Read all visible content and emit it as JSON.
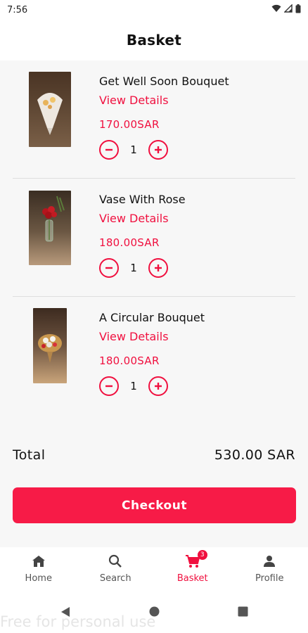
{
  "status_bar": {
    "time": "7:56"
  },
  "header": {
    "title": "Basket"
  },
  "items": [
    {
      "name": "Get Well Soon Bouquet",
      "details_label": "View Details",
      "price": "170.00SAR",
      "quantity": "1"
    },
    {
      "name": "Vase With Rose",
      "details_label": "View Details",
      "price": "180.00SAR",
      "quantity": "1"
    },
    {
      "name": "A Circular Bouquet",
      "details_label": "View Details",
      "price": "180.00SAR",
      "quantity": "1"
    }
  ],
  "total": {
    "label": "Total",
    "value": "530.00 SAR"
  },
  "checkout": {
    "label": "Checkout"
  },
  "bottom_nav": {
    "items": [
      {
        "label": "Home",
        "icon": "home-icon"
      },
      {
        "label": "Search",
        "icon": "search-icon"
      },
      {
        "label": "Basket",
        "icon": "cart-icon",
        "badge": "3",
        "active": true
      },
      {
        "label": "Profile",
        "icon": "person-icon"
      }
    ]
  },
  "watermark": "Free for personal use",
  "colors": {
    "accent": "#f0103f",
    "checkout_bg": "#f71b47",
    "list_bg": "#f7f7f7"
  }
}
